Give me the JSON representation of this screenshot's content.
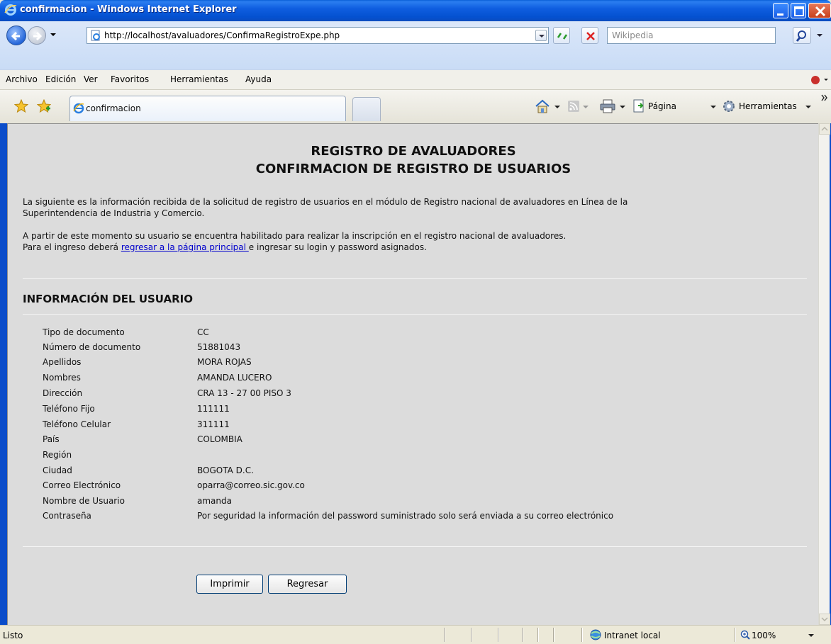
{
  "window": {
    "title": "confirmacion - Windows Internet Explorer"
  },
  "addressbar": {
    "url": "http://localhost/avaluadores/ConfirmaRegistroExpe.php",
    "search_placeholder": "Wikipedia"
  },
  "menu": {
    "items": [
      "Archivo",
      "Edición",
      "Ver",
      "Favoritos",
      "Herramientas",
      "Ayuda"
    ]
  },
  "tabs": {
    "active_label": "confirmacion",
    "toolbar_page": "Página",
    "toolbar_tools": "Herramientas"
  },
  "page": {
    "title_line1": "REGISTRO DE AVALUADORES",
    "title_line2": "CONFIRMACION DE REGISTRO DE USUARIOS",
    "intro_line1": "La siguiente es la información recibida de la solicitud de registro de usuarios en el módulo de Registro nacional de avaluadores en Línea de la",
    "intro_line2": "Superintendencia de Industria y Comercio.",
    "enabled_line": "A partir de este momento su usuario se encuentra habilitado para realizar la inscripción en el registro nacional de avaluadores.",
    "login_prefix": "Para el ingreso deberá ",
    "login_link": "regresar a la página principal ",
    "login_suffix": "e ingresar su login y password asignados.",
    "section_title": "INFORMACIÓN DEL USUARIO",
    "fields": [
      {
        "label": "Tipo de documento",
        "value": "CC"
      },
      {
        "label": "Número de documento",
        "value": "51881043"
      },
      {
        "label": "Apellidos",
        "value": "MORA ROJAS"
      },
      {
        "label": "Nombres",
        "value": "AMANDA LUCERO"
      },
      {
        "label": "Dirección",
        "value": "CRA 13 - 27 00 PISO 3"
      },
      {
        "label": "Teléfono Fijo",
        "value": "111111"
      },
      {
        "label": "Teléfono Celular",
        "value": "311111"
      },
      {
        "label": "País",
        "value": "COLOMBIA"
      },
      {
        "label": "Región",
        "value": ""
      },
      {
        "label": "Ciudad",
        "value": "BOGOTA D.C."
      },
      {
        "label": "Correo Electrónico",
        "value": "oparra@correo.sic.gov.co"
      },
      {
        "label": "Nombre de Usuario",
        "value": "amanda"
      },
      {
        "label": "Contraseña",
        "value": "Por seguridad la información del password suministrado solo será enviada a su correo electrónico"
      }
    ],
    "print_button": "Imprimir",
    "back_button": "Regresar"
  },
  "status": {
    "text": "Listo",
    "zone": "Intranet local",
    "zoom": "100%"
  }
}
